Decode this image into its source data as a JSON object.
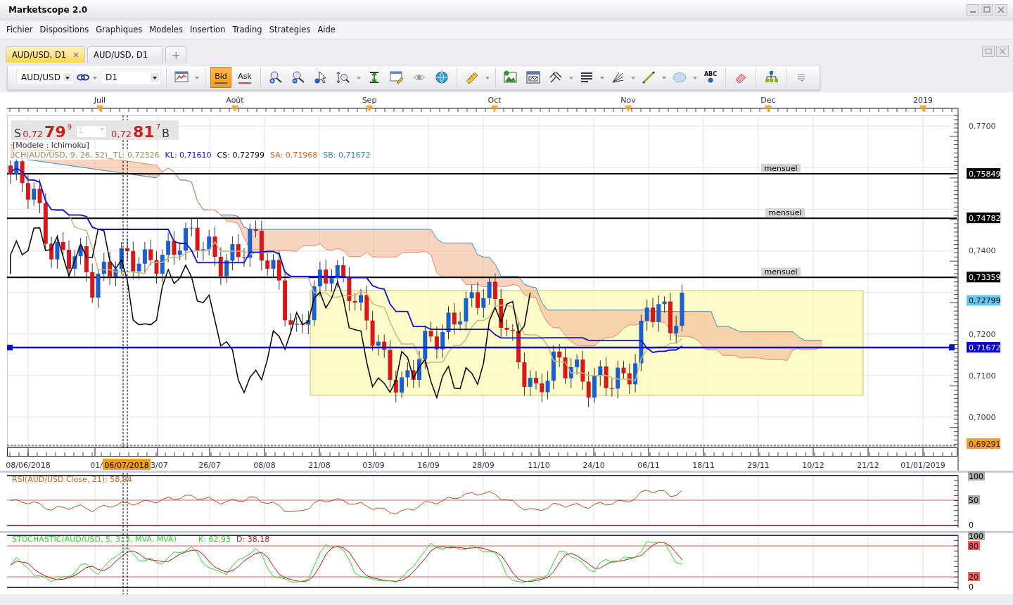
{
  "window": {
    "title": "Marketscope 2.0"
  },
  "menu": [
    "Fichier",
    "Dispositions",
    "Graphiques",
    "Modeles",
    "Insertion",
    "Trading",
    "Strategies",
    "Aide"
  ],
  "tabs": [
    {
      "label": "AUD/USD, D1",
      "selected": true
    },
    {
      "label": "AUD/USD, D1",
      "selected": false
    }
  ],
  "new_tab": "+",
  "toolbar": {
    "symbol": "AUD/USD",
    "timeframe": "D1",
    "price_buttons": [
      {
        "label": "Bid",
        "selected": true
      },
      {
        "label": "Ask",
        "selected": false
      }
    ],
    "text_tool": "ABC"
  },
  "chart": {
    "months": [
      "Juil",
      "Août",
      "Sep",
      "Oct",
      "Nov",
      "Dec",
      "2019"
    ],
    "quote": {
      "sell": "S",
      "sell_prefix": "0,72",
      "sell_pips": "79",
      "sell_fraction": "9",
      "amount": "1",
      "buy_prefix": "0,72",
      "buy_pips": "81",
      "buy_fraction": "7",
      "buy": "B"
    },
    "template": "[Modele : Ichimoku]",
    "legend": [
      {
        "text": "ICH(AUD/USD, 9, 26, 52)",
        "color": "#9a9058"
      },
      {
        "text": "TL: 0,72326",
        "color": "#9a9058"
      },
      {
        "text": "KL: 0,71610",
        "color": "#1010c0"
      },
      {
        "text": "CS: 0,72799",
        "color": "#000000"
      },
      {
        "text": "SA: 0,71968",
        "color": "#d06020"
      },
      {
        "text": "SB: 0,71672",
        "color": "#3080b0"
      }
    ],
    "levels": [
      {
        "label": "mensuel",
        "tag": "0,75849"
      },
      {
        "label": "mensuel",
        "tag": "0,74782"
      },
      {
        "label": "mensuel",
        "tag": "0,73359"
      }
    ],
    "price_axis": [
      "0,7700",
      "0,7400",
      "0,7200",
      "0,7100",
      "0,7000"
    ],
    "price_tags": [
      {
        "text": "0,72799",
        "color": "#66c8f0"
      },
      {
        "text": "0,71672",
        "color": "#0000c8"
      },
      {
        "text": "0,69291",
        "color": "#f0a020"
      }
    ],
    "dates": [
      "08/06/2018",
      "01/",
      "3/07",
      "26/07",
      "08/08",
      "21/08",
      "03/09",
      "16/09",
      "28/09",
      "11/10",
      "24/10",
      "06/11",
      "18/11",
      "29/11",
      "10/12",
      "21/12",
      "01/01/2019"
    ],
    "cursor_date": "06/07/2018"
  },
  "rsi": {
    "title": "RSI(AUD/USD.Close, 21): 58,94",
    "axis": [
      "100",
      "50",
      "0"
    ]
  },
  "stochastic": {
    "title": "STOCHASTIC(AUD/USD, 5, 3, 3, MVA, MVA)",
    "k": "K: 62,93",
    "d": "D: 38,18",
    "axis": [
      "100",
      "80",
      "20",
      "0"
    ]
  }
}
